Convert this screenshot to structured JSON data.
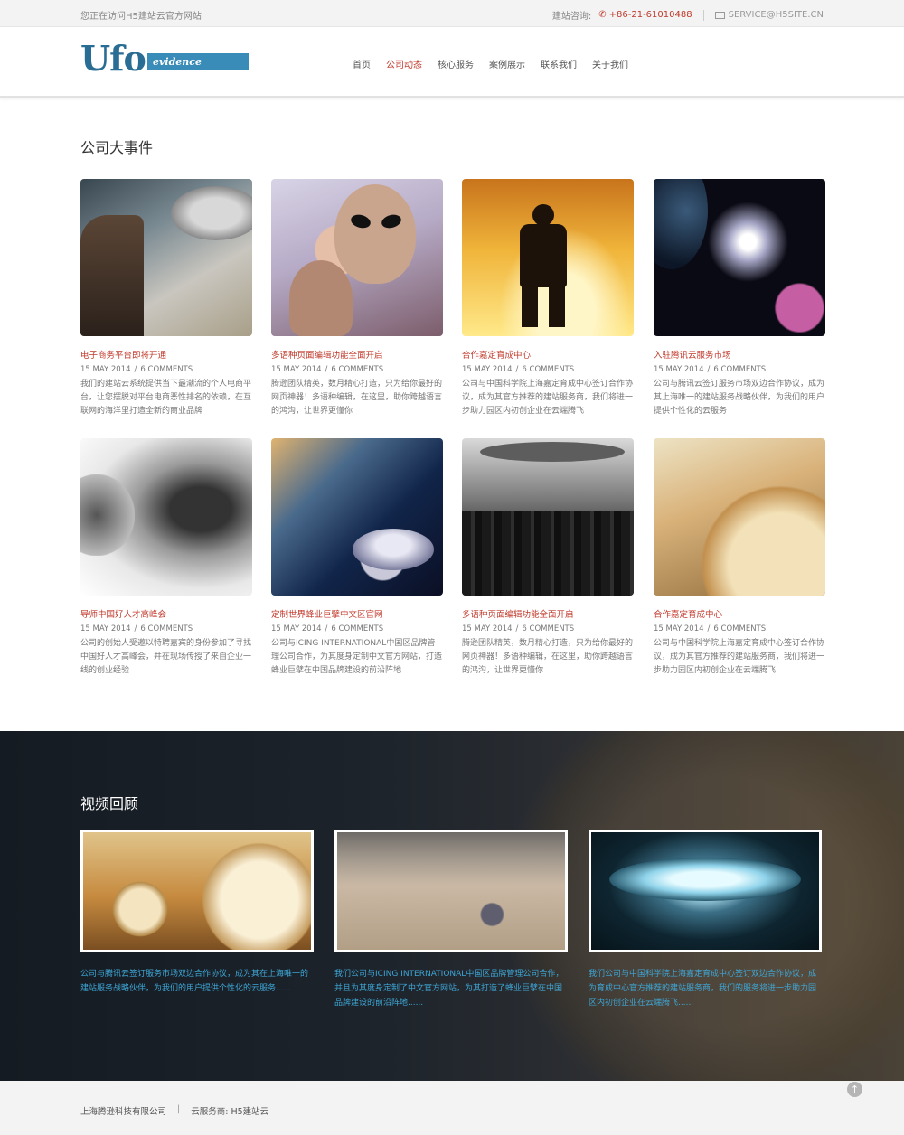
{
  "topbar": {
    "visit_text": "您正在访问H5建站云官方网站",
    "consult_label": "建站咨询:",
    "phone": "+86-21-61010488",
    "email": "SERVICE@H5SITE.CN"
  },
  "logo": {
    "main": "Ufo",
    "sub": "evidence"
  },
  "nav": [
    {
      "label": "首页",
      "active": false
    },
    {
      "label": "公司动态",
      "active": true
    },
    {
      "label": "核心服务",
      "active": false
    },
    {
      "label": "案例展示",
      "active": false
    },
    {
      "label": "联系我们",
      "active": false
    },
    {
      "label": "关于我们",
      "active": false
    }
  ],
  "events": {
    "title": "公司大事件",
    "items": [
      {
        "title": "电子商务平台即将开通",
        "date": "15 MAY 2014",
        "comments": "6 COMMENTS",
        "desc": "我们的建站云系统提供当下最潮流的个人电商平台，让您摆脱对平台电商恶性排名的依赖，在互联网的海洋里打造全新的商业品牌"
      },
      {
        "title": "多语种页面编辑功能全面开启",
        "date": "15 MAY 2014",
        "comments": "6 COMMENTS",
        "desc": "腾逊团队精英，数月精心打造，只为给你最好的网页神器！多语种编辑，在这里，助你跨越语言的鸿沟，让世界更懂你"
      },
      {
        "title": "合作嘉定育成中心",
        "date": "15 MAY 2014",
        "comments": "6 COMMENTS",
        "desc": "公司与中国科学院上海嘉定育成中心签订合作协议，成为其官方推荐的建站服务商，我们将进一步助力园区内初创企业在云端腾飞"
      },
      {
        "title": "入驻腾讯云服务市场",
        "date": "15 MAY 2014",
        "comments": "6 COMMENTS",
        "desc": "公司与腾讯云签订服务市场双边合作协议，成为其上海唯一的建站服务战略伙伴，为我们的用户提供个性化的云服务"
      },
      {
        "title": "导师中国好人才高峰会",
        "date": "15 MAY 2014",
        "comments": "6 COMMENTS",
        "desc": "公司的创始人受邀以特聘嘉宾的身份参加了寻找中国好人才高峰会，并在现场传授了来自企业一线的创业经验"
      },
      {
        "title": "定制世界蜂业巨擘中文区官网",
        "date": "15 MAY 2014",
        "comments": "6 COMMENTS",
        "desc": "公司与ICING INTERNATIONAL中国区品牌管理公司合作，为其度身定制中文官方网站，打造蜂业巨擘在中国品牌建设的前沿阵地"
      },
      {
        "title": "多语种页面编辑功能全面开启",
        "date": "15 MAY 2014",
        "comments": "6 COMMENTS",
        "desc": "腾逊团队精英，数月精心打造，只为给你最好的网页神器！多语种编辑，在这里，助你跨越语言的鸿沟，让世界更懂你"
      },
      {
        "title": "合作嘉定育成中心",
        "date": "15 MAY 2014",
        "comments": "6 COMMENTS",
        "desc": "公司与中国科学院上海嘉定育成中心签订合作协议，成为其官方推荐的建站服务商，我们将进一步助力园区内初创企业在云端腾飞"
      }
    ]
  },
  "videos": {
    "title": "视频回顾",
    "items": [
      {
        "desc": "公司与腾讯云签订服务市场双边合作协议，成为其在上海唯一的建站服务战略伙伴，为我们的用户提供个性化的云服务......"
      },
      {
        "desc": "我们公司与ICING INTERNATIONAL中国区品牌管理公司合作，并且为其度身定制了中文官方网站，为其打造了蜂业巨擘在中国品牌建设的前沿阵地......"
      },
      {
        "desc": "我们公司与中国科学院上海嘉定育成中心签订双边合作协议，成为育成中心官方推荐的建站服务商，我们的服务将进一步助力园区内初创企业在云端腾飞......"
      }
    ]
  },
  "footer": {
    "company": "上海腾逊科技有限公司",
    "provider": "云服务商: H5建站云"
  },
  "colors": {
    "accent": "#c0392b",
    "brand": "#2a6d94",
    "link_blue": "#3ea6d6"
  }
}
